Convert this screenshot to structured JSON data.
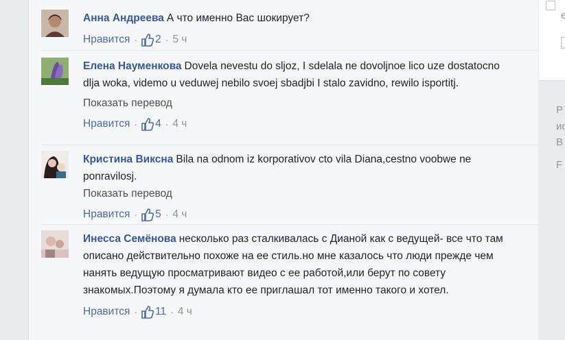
{
  "comments": [
    {
      "author": "Анна Андреева",
      "text": "А что именно Вас шокирует?",
      "like_label": "Нравится",
      "likes": "2",
      "time": "5 ч",
      "avatar_colors": [
        "#c7a98f",
        "#3a2a20"
      ]
    },
    {
      "author": "Елена Науменкова",
      "text": "Dovela nevestu do sljoz, I sdelala ne dovoljnoe lico uze dostatocno dlja woka, videmo u veduwej nebilo svoej sbadjbi I stalo zavidno, rewilo isportitj.",
      "translate_label": "Показать перевод",
      "like_label": "Нравится",
      "likes": "4",
      "time": "4 ч",
      "avatar_colors": [
        "#6d4e9c",
        "#4d7a3a"
      ]
    },
    {
      "author": "Кристина Виксна",
      "text": "Bila na odnom iz korporativov cto vila Diana,cestno voobwe ne ponravilosj.",
      "translate_label": "Показать перевод",
      "like_label": "Нравится",
      "likes": "5",
      "time": "4 ч",
      "avatar_colors": [
        "#e3c8b8",
        "#2a1d1a"
      ]
    },
    {
      "author": "Инесса Семёнова",
      "text": "несколько раз сталкивалась с Дианой как с ведущей- все что там описано действительно похоже на ее стиль.но мне казалось что люди прежде чем нанять ведущую просматривают видео с ее работой,или берут по совету знакомых.Поэтому я думала кто ее приглашал тот именно такого и хотел.",
      "like_label": "Нравится",
      "likes": "11",
      "time": "4 ч",
      "avatar_colors": [
        "#d9c2c0",
        "#a4847f"
      ]
    }
  ],
  "edge_letters": [
    "е",
    "Р",
    "ис",
    "В",
    "F"
  ],
  "colors": {
    "author": "#365899",
    "like": "#4b6aa8",
    "meta": "#90949c"
  },
  "icons": {
    "like": "thumbs-up-icon"
  }
}
